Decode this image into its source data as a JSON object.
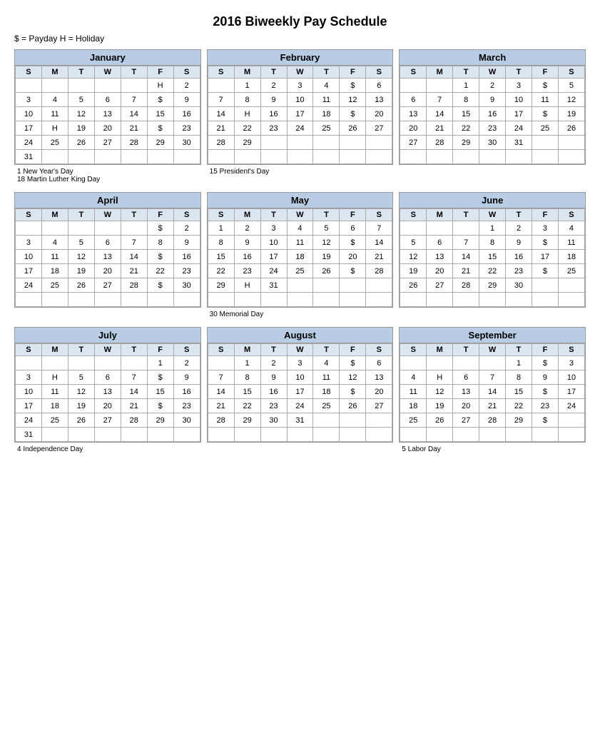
{
  "title": "2016 Biweekly Pay Schedule",
  "legend": "$ = Payday     H = Holiday",
  "months": [
    {
      "name": "January",
      "days": [
        "S",
        "M",
        "T",
        "W",
        "T",
        "F",
        "S"
      ],
      "weeks": [
        [
          "",
          "",
          "",
          "",
          "",
          "H",
          "2"
        ],
        [
          "3",
          "4",
          "5",
          "6",
          "7",
          "$",
          "9"
        ],
        [
          "10",
          "11",
          "12",
          "13",
          "14",
          "15",
          "16"
        ],
        [
          "17",
          "H",
          "19",
          "20",
          "21",
          "$",
          "23"
        ],
        [
          "24",
          "25",
          "26",
          "27",
          "28",
          "29",
          "30"
        ],
        [
          "31",
          "",
          "",
          "",
          "",
          "",
          ""
        ]
      ],
      "notes": [
        "1 New Year's Day",
        "18 Martin Luther King Day"
      ]
    },
    {
      "name": "February",
      "days": [
        "S",
        "M",
        "T",
        "W",
        "T",
        "F",
        "S"
      ],
      "weeks": [
        [
          "",
          "1",
          "2",
          "3",
          "4",
          "$",
          "6"
        ],
        [
          "7",
          "8",
          "9",
          "10",
          "11",
          "12",
          "13"
        ],
        [
          "14",
          "H",
          "16",
          "17",
          "18",
          "$",
          "20"
        ],
        [
          "21",
          "22",
          "23",
          "24",
          "25",
          "26",
          "27"
        ],
        [
          "28",
          "29",
          "",
          "",
          "",
          "",
          ""
        ],
        [
          "",
          "",
          "",
          "",
          "",
          "",
          ""
        ]
      ],
      "notes": [
        "15  President's Day"
      ]
    },
    {
      "name": "March",
      "days": [
        "S",
        "M",
        "T",
        "W",
        "T",
        "F",
        "S"
      ],
      "weeks": [
        [
          "",
          "",
          "1",
          "2",
          "3",
          "$",
          "5"
        ],
        [
          "6",
          "7",
          "8",
          "9",
          "10",
          "11",
          "12"
        ],
        [
          "13",
          "14",
          "15",
          "16",
          "17",
          "$",
          "19"
        ],
        [
          "20",
          "21",
          "22",
          "23",
          "24",
          "25",
          "26"
        ],
        [
          "27",
          "28",
          "29",
          "30",
          "31",
          "",
          ""
        ],
        [
          "",
          "",
          "",
          "",
          "",
          "",
          ""
        ]
      ],
      "notes": []
    },
    {
      "name": "April",
      "days": [
        "S",
        "M",
        "T",
        "W",
        "T",
        "F",
        "S"
      ],
      "weeks": [
        [
          "",
          "",
          "",
          "",
          "",
          "$",
          "2"
        ],
        [
          "3",
          "4",
          "5",
          "6",
          "7",
          "8",
          "9"
        ],
        [
          "10",
          "11",
          "12",
          "13",
          "14",
          "$",
          "16"
        ],
        [
          "17",
          "18",
          "19",
          "20",
          "21",
          "22",
          "23"
        ],
        [
          "24",
          "25",
          "26",
          "27",
          "28",
          "$",
          "30"
        ],
        [
          "",
          "",
          "",
          "",
          "",
          "",
          ""
        ]
      ],
      "notes": []
    },
    {
      "name": "May",
      "days": [
        "S",
        "M",
        "T",
        "W",
        "T",
        "F",
        "S"
      ],
      "weeks": [
        [
          "1",
          "2",
          "3",
          "4",
          "5",
          "6",
          "7"
        ],
        [
          "8",
          "9",
          "10",
          "11",
          "12",
          "$",
          "14"
        ],
        [
          "15",
          "16",
          "17",
          "18",
          "19",
          "20",
          "21"
        ],
        [
          "22",
          "23",
          "24",
          "25",
          "26",
          "$",
          "28"
        ],
        [
          "29",
          "H",
          "31",
          "",
          "",
          "",
          ""
        ],
        [
          "",
          "",
          "",
          "",
          "",
          "",
          ""
        ]
      ],
      "notes": [
        "30  Memorial Day"
      ]
    },
    {
      "name": "June",
      "days": [
        "S",
        "M",
        "T",
        "W",
        "T",
        "F",
        "S"
      ],
      "weeks": [
        [
          "",
          "",
          "",
          "1",
          "2",
          "3",
          "4"
        ],
        [
          "5",
          "6",
          "7",
          "8",
          "9",
          "$",
          "11"
        ],
        [
          "12",
          "13",
          "14",
          "15",
          "16",
          "17",
          "18"
        ],
        [
          "19",
          "20",
          "21",
          "22",
          "23",
          "$",
          "25"
        ],
        [
          "26",
          "27",
          "28",
          "29",
          "30",
          "",
          ""
        ],
        [
          "",
          "",
          "",
          "",
          "",
          "",
          ""
        ]
      ],
      "notes": []
    },
    {
      "name": "July",
      "days": [
        "S",
        "M",
        "T",
        "W",
        "T",
        "F",
        "S"
      ],
      "weeks": [
        [
          "",
          "",
          "",
          "",
          "",
          "1",
          "2"
        ],
        [
          "3",
          "H",
          "5",
          "6",
          "7",
          "$",
          "9"
        ],
        [
          "10",
          "11",
          "12",
          "13",
          "14",
          "15",
          "16"
        ],
        [
          "17",
          "18",
          "19",
          "20",
          "21",
          "$",
          "23"
        ],
        [
          "24",
          "25",
          "26",
          "27",
          "28",
          "29",
          "30"
        ],
        [
          "31",
          "",
          "",
          "",
          "",
          "",
          ""
        ]
      ],
      "notes": [
        "4 Independence Day"
      ]
    },
    {
      "name": "August",
      "days": [
        "S",
        "M",
        "T",
        "W",
        "T",
        "F",
        "S"
      ],
      "weeks": [
        [
          "",
          "1",
          "2",
          "3",
          "4",
          "$",
          "6"
        ],
        [
          "7",
          "8",
          "9",
          "10",
          "11",
          "12",
          "13"
        ],
        [
          "14",
          "15",
          "16",
          "17",
          "18",
          "$",
          "20"
        ],
        [
          "21",
          "22",
          "23",
          "24",
          "25",
          "26",
          "27"
        ],
        [
          "28",
          "29",
          "30",
          "31",
          "",
          "",
          ""
        ],
        [
          "",
          "",
          "",
          "",
          "",
          "",
          ""
        ]
      ],
      "notes": []
    },
    {
      "name": "September",
      "days": [
        "S",
        "M",
        "T",
        "W",
        "T",
        "F",
        "S"
      ],
      "weeks": [
        [
          "",
          "",
          "",
          "",
          "1",
          "$",
          "3"
        ],
        [
          "4",
          "H",
          "6",
          "7",
          "8",
          "9",
          "10"
        ],
        [
          "11",
          "12",
          "13",
          "14",
          "15",
          "$",
          "17"
        ],
        [
          "18",
          "19",
          "20",
          "21",
          "22",
          "23",
          "24"
        ],
        [
          "25",
          "26",
          "27",
          "28",
          "29",
          "$",
          ""
        ],
        [
          "",
          "",
          "",
          "",
          "",
          "",
          ""
        ]
      ],
      "notes": [
        "5 Labor Day"
      ]
    }
  ]
}
